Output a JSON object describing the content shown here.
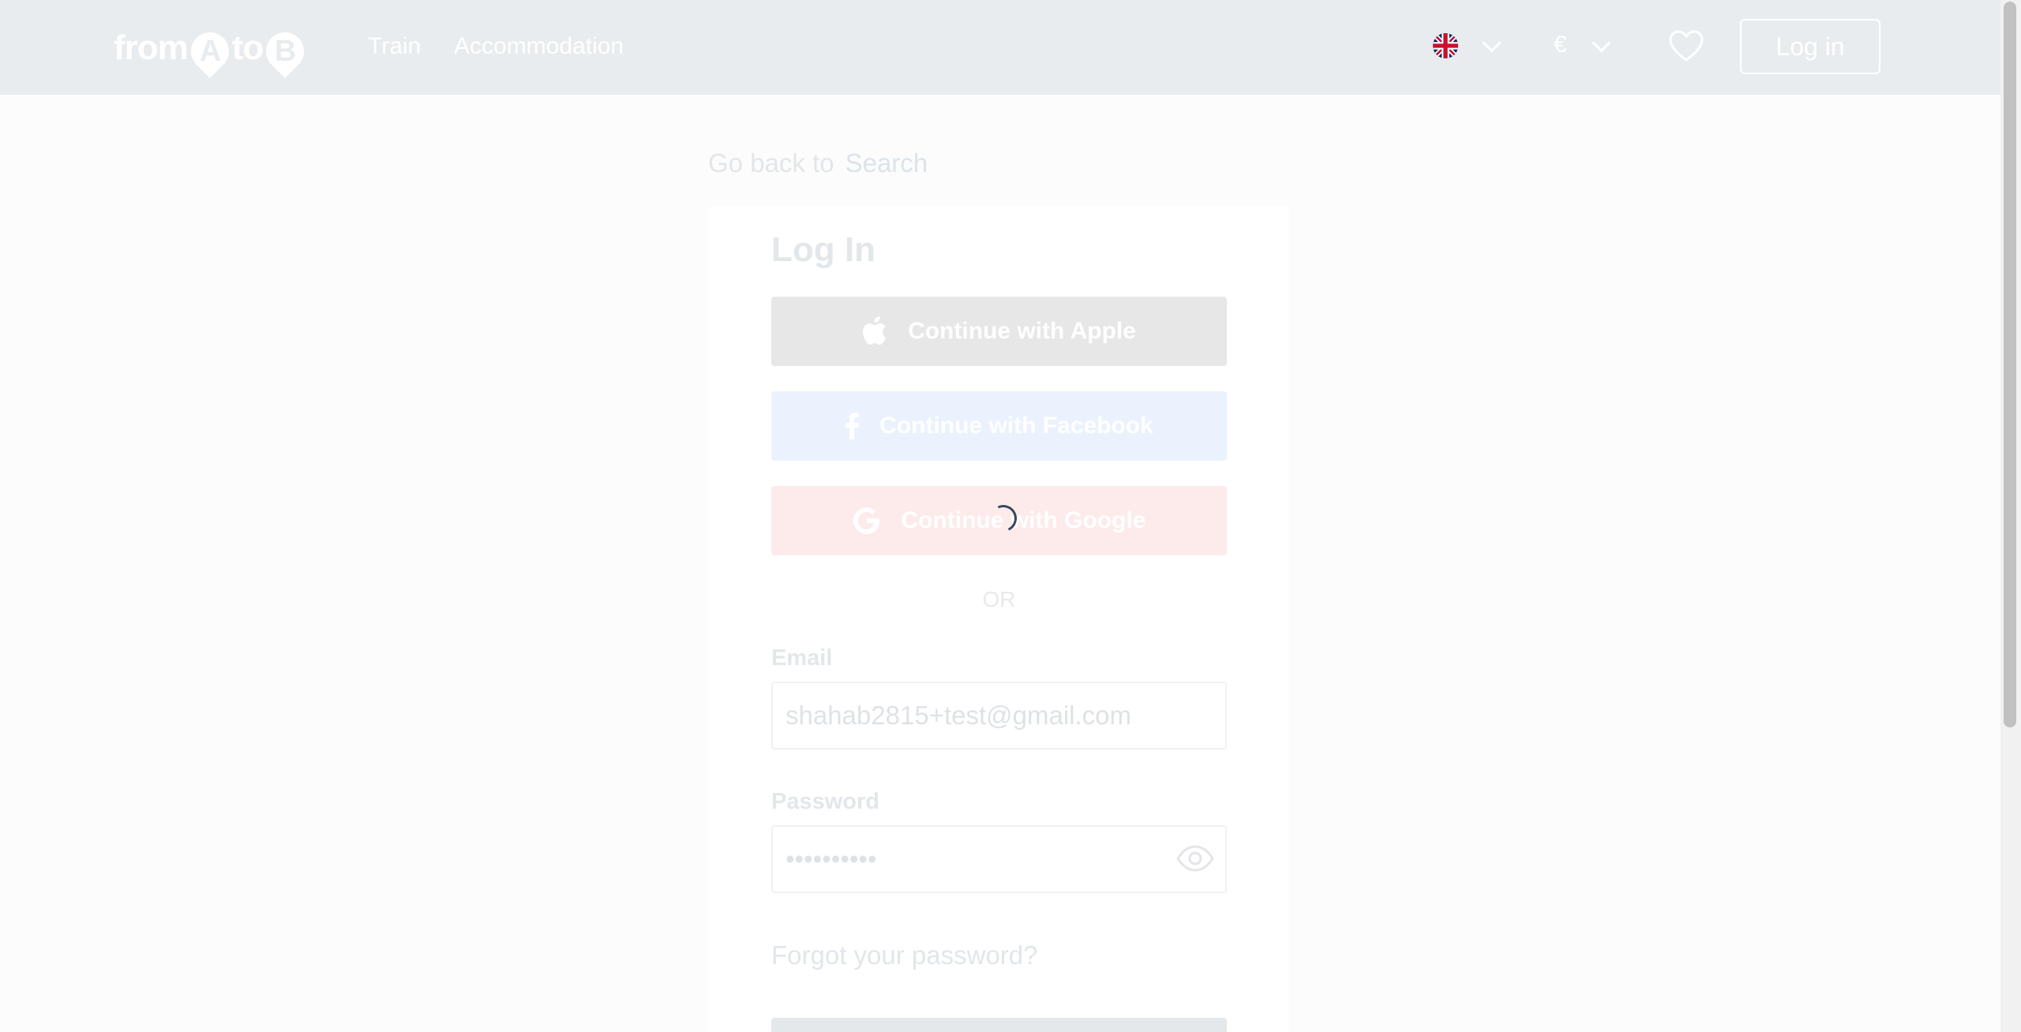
{
  "header": {
    "logo_parts": [
      "from",
      "A",
      "to",
      "B"
    ],
    "nav": [
      "Train",
      "Accommodation"
    ],
    "currency": "€",
    "login_label": "Log in"
  },
  "breadcrumb": {
    "prefix": "Go back to",
    "link": "Search"
  },
  "login_card": {
    "title": "Log In",
    "apple_label": "Continue with Apple",
    "facebook_label": "Continue with Facebook",
    "google_label": "Continue with Google",
    "separator": "OR",
    "email_label": "Email",
    "email_value": "shahab2815+test@gmail.com",
    "password_label": "Password",
    "password_value": "••••••••••",
    "forgot_label": "Forgot your password?"
  },
  "icons": {
    "flag": "uk-flag-icon",
    "favorites": "heart-icon",
    "apple": "apple-icon",
    "facebook": "facebook-icon",
    "google": "google-icon",
    "show_password": "eye-icon",
    "loading": "spinner-icon"
  },
  "colors": {
    "header_bg": "#e8ecee",
    "apple_bg": "#e7e7e7",
    "facebook_bg": "#ebf2fd",
    "google_bg": "#fdebeb",
    "spinner": "#34495e"
  }
}
